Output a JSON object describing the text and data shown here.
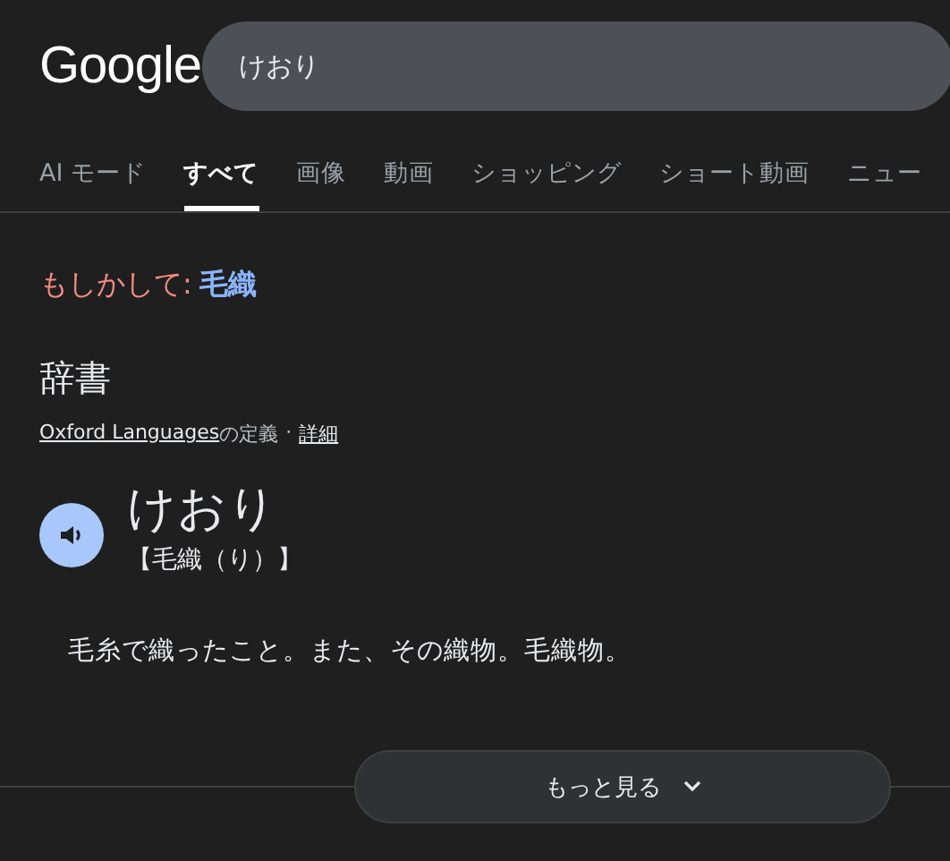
{
  "header": {
    "logo": "Google",
    "search": {
      "value": "けおり"
    }
  },
  "tabs": [
    {
      "label": "AI モード",
      "selected": false
    },
    {
      "label": "すべて",
      "selected": true
    },
    {
      "label": "画像",
      "selected": false
    },
    {
      "label": "動画",
      "selected": false
    },
    {
      "label": "ショッピング",
      "selected": false
    },
    {
      "label": "ショート動画",
      "selected": false
    },
    {
      "label": "ニュー",
      "selected": false
    }
  ],
  "suggestion": {
    "prefix": "もしかして:",
    "link": "毛織"
  },
  "dictionary": {
    "heading": "辞書",
    "source": "Oxford Languages",
    "source_suffix": "の定義",
    "separator": "·",
    "details": "詳細",
    "word": "けおり",
    "kanji": "【毛織（り）】",
    "definition": "毛糸で織ったこと。また、その織物。毛織物。"
  },
  "more_button": {
    "label": "もっと見る"
  }
}
